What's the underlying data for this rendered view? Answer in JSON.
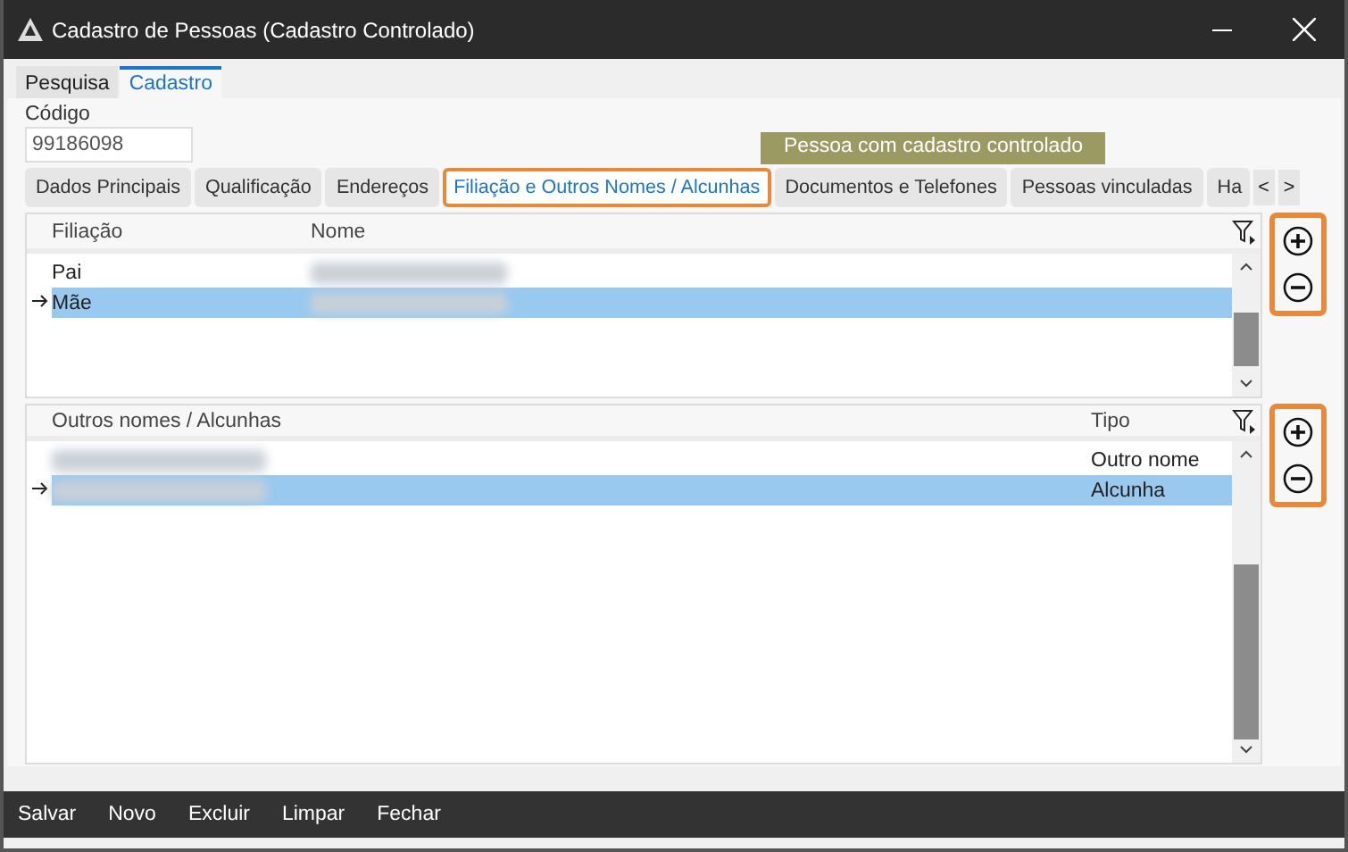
{
  "window": {
    "title": "Cadastro de Pessoas (Cadastro Controlado)"
  },
  "top_tabs": [
    {
      "label": "Pesquisa",
      "selected": false
    },
    {
      "label": "Cadastro",
      "selected": true
    }
  ],
  "codigo": {
    "label": "Código",
    "value": "99186098"
  },
  "badge": "Pessoa com cadastro controlado",
  "tabs": [
    {
      "label": "Dados Principais",
      "selected": false,
      "highlighted": false
    },
    {
      "label": "Qualificação",
      "selected": false,
      "highlighted": false
    },
    {
      "label": "Endereços",
      "selected": false,
      "highlighted": false
    },
    {
      "label": "Filiação e Outros Nomes / Alcunhas",
      "selected": true,
      "highlighted": true
    },
    {
      "label": "Documentos e Telefones",
      "selected": false,
      "highlighted": false
    },
    {
      "label": "Pessoas vinculadas",
      "selected": false,
      "highlighted": false
    },
    {
      "label": "Ha",
      "selected": false,
      "highlighted": false
    }
  ],
  "tab_scroll": [
    "<",
    ">"
  ],
  "grids": [
    {
      "columns": [
        "Filiação",
        "Nome"
      ],
      "buttons_highlighted": true,
      "rows": [
        {
          "cells": [
            "Pai",
            ""
          ],
          "blurred": [
            false,
            true
          ],
          "selected": false
        },
        {
          "cells": [
            "Mãe",
            ""
          ],
          "blurred": [
            false,
            true
          ],
          "selected": true
        }
      ]
    },
    {
      "columns": [
        "Outros nomes / Alcunhas",
        "Tipo"
      ],
      "buttons_highlighted": true,
      "rows": [
        {
          "cells": [
            "",
            "Outro nome"
          ],
          "blurred": [
            true,
            false
          ],
          "selected": false
        },
        {
          "cells": [
            "",
            "Alcunha"
          ],
          "blurred": [
            true,
            false
          ],
          "selected": true
        }
      ]
    }
  ],
  "footer": [
    "Salvar",
    "Novo",
    "Excluir",
    "Limpar",
    "Fechar"
  ]
}
